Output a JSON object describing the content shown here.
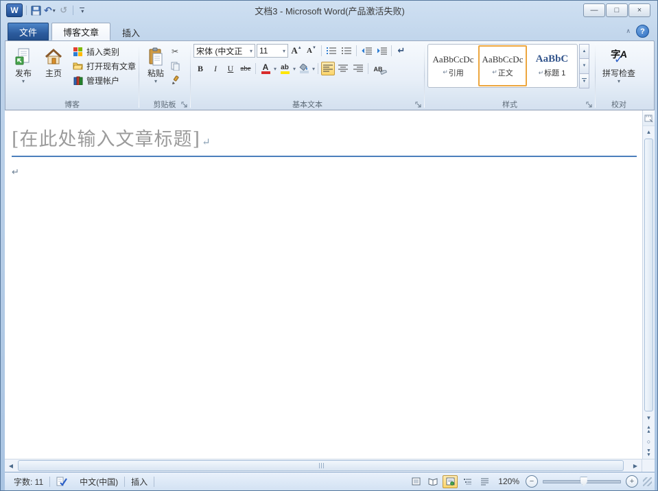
{
  "window": {
    "title": "文档3 - Microsoft Word(产品激活失败)"
  },
  "glyphs": {
    "word_logo": "W",
    "caret_down": "▾",
    "undo": "↶",
    "redo": "↺",
    "collapse_chevron": "∧",
    "help": "?",
    "minimize": "—",
    "maximize": "□",
    "close": "×",
    "cut": "✂",
    "scroll_up": "▲",
    "scroll_down": "▼",
    "scroll_left": "◀",
    "scroll_right": "▶",
    "browse_circle": "○",
    "paragraph_mark": "↵",
    "check": "✓",
    "minus": "−",
    "plus": "+",
    "bold": "B",
    "italic": "I",
    "underline": "U",
    "strikethrough": "abe",
    "grow_letter": "A",
    "shrink_letter": "A",
    "font_color_letter": "A",
    "highlight_letters": "ab",
    "clear_letters": "AB",
    "marks_icon": "↵"
  },
  "tabs": [
    {
      "label": "文件"
    },
    {
      "label": "博客文章"
    },
    {
      "label": "插入"
    }
  ],
  "ribbon": {
    "blog": {
      "label": "博客",
      "publish": "发布",
      "home": "主页",
      "insert_category": "插入类别",
      "open_existing": "打开现有文章",
      "manage_accounts": "管理帐户"
    },
    "clipboard": {
      "label": "剪贴板",
      "paste": "粘贴"
    },
    "basic_text": {
      "label": "基本文本",
      "font_name": "宋体 (中文正",
      "font_size": "11"
    },
    "styles": {
      "label": "样式",
      "items": [
        {
          "preview": "AaBbCcDc",
          "name": "引用"
        },
        {
          "preview": "AaBbCcDc",
          "name": "正文"
        },
        {
          "preview": "AaBbC",
          "name": "标题 1"
        }
      ]
    },
    "proofing": {
      "label": "校对",
      "spell_glyph": "字A",
      "spell_label": "拼写检查"
    }
  },
  "document": {
    "title_placeholder": "[在此处输入文章标题]"
  },
  "status": {
    "word_count": "字数: 11",
    "language": "中文(中国)",
    "insert_mode": "插入",
    "zoom_level": "120%"
  },
  "colors": {
    "selection_orange": "#eda63d",
    "title_rule_blue": "#4a7ebc",
    "file_tab_blue": "#2c5c9e"
  }
}
